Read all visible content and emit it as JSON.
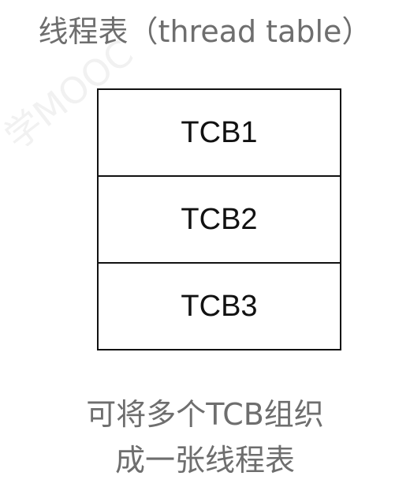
{
  "title": "线程表（thread table）",
  "table": {
    "rows": [
      "TCB1",
      "TCB2",
      "TCB3"
    ]
  },
  "caption": {
    "line1": "可将多个TCB组织",
    "line2": "成一张线程表"
  }
}
